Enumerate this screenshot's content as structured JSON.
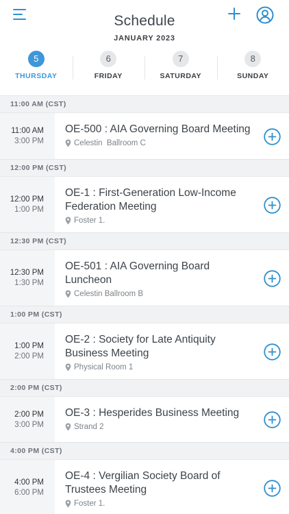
{
  "header": {
    "title": "Schedule",
    "month": "JANUARY 2023",
    "accent_color": "#2f8fce",
    "menu_icon": "hamburger-menu-icon",
    "add_icon": "plus-icon",
    "profile_icon": "user-circle-icon"
  },
  "days": [
    {
      "num": "5",
      "name": "THURSDAY",
      "active": true
    },
    {
      "num": "6",
      "name": "FRIDAY",
      "active": false
    },
    {
      "num": "7",
      "name": "SATURDAY",
      "active": false
    },
    {
      "num": "8",
      "name": "SUNDAY",
      "active": false
    }
  ],
  "sections": [
    {
      "label": "11:00 AM (CST)",
      "event": {
        "start": "11:00 AM",
        "end": "3:00 PM",
        "title": "OE-500 : AIA Governing Board Meeting",
        "location": "Celestin  Ballroom C"
      }
    },
    {
      "label": "12:00 PM (CST)",
      "event": {
        "start": "12:00 PM",
        "end": "1:00 PM",
        "title": "OE-1 : First-Generation Low-Income Federation Meeting",
        "location": "Foster 1."
      }
    },
    {
      "label": "12:30 PM (CST)",
      "event": {
        "start": "12:30 PM",
        "end": "1:30 PM",
        "title": "OE-501 : AIA Governing Board Luncheon",
        "location": "Celestin Ballroom B"
      }
    },
    {
      "label": "1:00 PM (CST)",
      "event": {
        "start": "1:00 PM",
        "end": "2:00 PM",
        "title": "OE-2 : Society for Late Antiquity Business Meeting",
        "location": "Physical Room 1"
      }
    },
    {
      "label": "2:00 PM (CST)",
      "event": {
        "start": "2:00 PM",
        "end": "3:00 PM",
        "title": "OE-3 : Hesperides Business Meeting",
        "location": "Strand 2"
      }
    },
    {
      "label": "4:00 PM (CST)",
      "event": {
        "start": "4:00 PM",
        "end": "6:00 PM",
        "title": "OE-4 : Vergilian Society Board of Trustees Meeting",
        "location": "Foster 1."
      }
    }
  ]
}
